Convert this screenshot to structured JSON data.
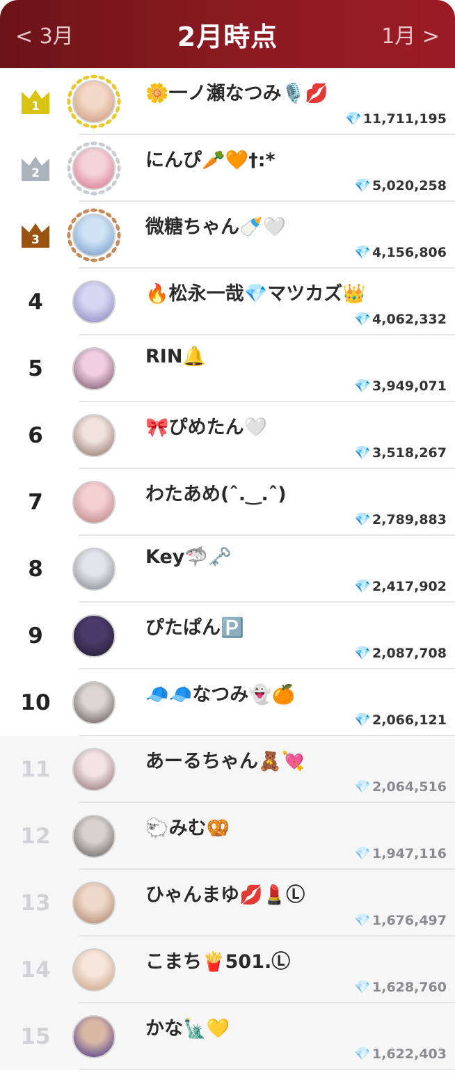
{
  "header": {
    "prev_label": "< 3月",
    "title": "2月時点",
    "next_label": "1月 >"
  },
  "colors": {
    "gold": "#d8c311",
    "silver": "#a9b2bd",
    "bronze": "#9a520f",
    "accent": "#8d1a22"
  },
  "entries": [
    {
      "rank": "1",
      "name": "🌼一ノ瀬なつみ🎙️💋",
      "score": "11,711,195",
      "avatar": [
        "#f3d9c7",
        "#c98f72"
      ]
    },
    {
      "rank": "2",
      "name": "にんぴ🥕🧡†:*",
      "score": "5,020,258",
      "avatar": [
        "#f4d4dc",
        "#d86b8a"
      ]
    },
    {
      "rank": "3",
      "name": "微糖ちゃん🍼🤍",
      "score": "4,156,806",
      "avatar": [
        "#cfe3f5",
        "#6c93c4"
      ]
    },
    {
      "rank": "4",
      "name": "🔥松永一哉💎マツカズ👑",
      "score": "4,062,332",
      "avatar": [
        "#d9d6f3",
        "#7f7fb8"
      ]
    },
    {
      "rank": "5",
      "name": "RIN🔔",
      "score": "3,949,071",
      "avatar": [
        "#f0cfe2",
        "#6f4b63"
      ]
    },
    {
      "rank": "6",
      "name": "🎀ぴめたん🤍",
      "score": "3,518,267",
      "avatar": [
        "#f0e2dc",
        "#8a6b62"
      ]
    },
    {
      "rank": "7",
      "name": "わたあめ(ˆ.‿.ˆ)",
      "score": "2,789,883",
      "avatar": [
        "#f4d0d2",
        "#b6787c"
      ]
    },
    {
      "rank": "8",
      "name": "Key🦈🗝️",
      "score": "2,417,902",
      "avatar": [
        "#e2e4e8",
        "#7d8087"
      ]
    },
    {
      "rank": "9",
      "name": "ぴたぱん🅿️",
      "score": "2,087,708",
      "avatar": [
        "#4a3a6a",
        "#1f1a2d"
      ]
    },
    {
      "rank": "10",
      "name": "🧢🧢なつみ👻🍊",
      "score": "2,066,121",
      "avatar": [
        "#d9d6d4",
        "#5b4e4a"
      ]
    },
    {
      "rank": "11",
      "name": "あーるちゃん🧸💘",
      "score": "2,064,516",
      "avatar": [
        "#f1e3e6",
        "#8b6a6e"
      ]
    },
    {
      "rank": "12",
      "name": "🐑みむ🥨",
      "score": "1,947,116",
      "avatar": [
        "#d7d2cf",
        "#5e5753"
      ]
    },
    {
      "rank": "13",
      "name": "ひゃんまゆ💋💄Ⓛ",
      "score": "1,676,497",
      "avatar": [
        "#efd8c9",
        "#a77d64"
      ]
    },
    {
      "rank": "14",
      "name": "こまち🍟501.Ⓛ",
      "score": "1,628,760",
      "avatar": [
        "#f6e6db",
        "#c79a7c"
      ]
    },
    {
      "rank": "15",
      "name": "かな🗽💛",
      "score": "1,622,403",
      "avatar": [
        "#d9b8a6",
        "#3e2d8c"
      ]
    }
  ]
}
